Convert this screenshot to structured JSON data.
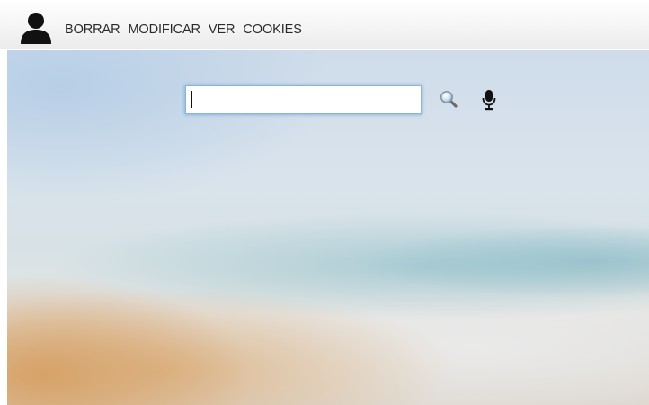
{
  "toolbar": {
    "avatar_icon": "user-silhouette-icon",
    "menu": [
      {
        "label": "BORRAR"
      },
      {
        "label": "MODIFICAR"
      },
      {
        "label": "VER"
      },
      {
        "label": "COOKIES"
      }
    ]
  },
  "search": {
    "value": "",
    "search_icon": "magnifier-icon",
    "mic_icon": "microphone-icon"
  },
  "colors": {
    "toolbar_bg": "#f4f4f4",
    "search_focus": "#8fb4d8",
    "text": "#2a2a2a"
  }
}
